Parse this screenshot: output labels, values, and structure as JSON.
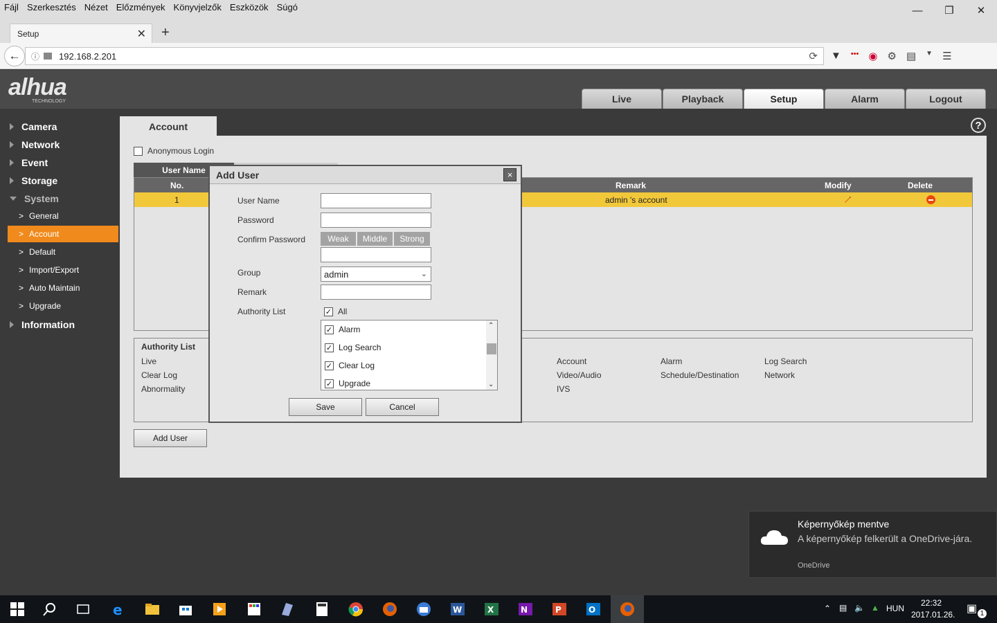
{
  "browser": {
    "menu": [
      "Fájl",
      "Szerkesztés",
      "Nézet",
      "Előzmények",
      "Könyvjelzők",
      "Eszközök",
      "Súgó"
    ],
    "tab_title": "Setup",
    "url": "192.168.2.201"
  },
  "header": {
    "logo": "alhua",
    "logo_sub": "TECHNOLOGY",
    "nav": [
      "Live",
      "Playback",
      "Setup",
      "Alarm",
      "Logout"
    ],
    "active_nav": "Setup"
  },
  "sidebar": {
    "items": [
      {
        "label": "Camera"
      },
      {
        "label": "Network"
      },
      {
        "label": "Event"
      },
      {
        "label": "Storage"
      },
      {
        "label": "System"
      }
    ],
    "system_sub": [
      "General",
      "Account",
      "Default",
      "Import/Export",
      "Auto Maintain",
      "Upgrade"
    ],
    "active_sub": "Account",
    "information": "Information"
  },
  "content": {
    "tab": "Account",
    "help": "?",
    "anonymous_login": "Anonymous Login",
    "user_tab": "User Name",
    "table": {
      "headers": {
        "no": "No.",
        "remark": "Remark",
        "modify": "Modify",
        "delete": "Delete"
      },
      "rows": [
        {
          "no": "1",
          "remark": "admin 's account"
        }
      ]
    },
    "authority": {
      "title": "Authority List",
      "col1": [
        "Live",
        "Clear Log",
        "Abnormality"
      ],
      "col2": [
        "Account",
        "Video/Audio",
        "IVS"
      ],
      "col3": [
        "Alarm",
        "Schedule/Destination"
      ],
      "col4": [
        "Log Search",
        "Network"
      ]
    },
    "add_user_button": "Add User"
  },
  "modal": {
    "title": "Add User",
    "close": "×",
    "labels": {
      "username": "User Name",
      "password": "Password",
      "confirm": "Confirm Password",
      "group": "Group",
      "remark": "Remark",
      "authority": "Authority List"
    },
    "strength": [
      "Weak",
      "Middle",
      "Strong"
    ],
    "group_value": "admin",
    "all_label": "All",
    "authority_items": [
      "Alarm",
      "Log Search",
      "Clear Log",
      "Upgrade"
    ],
    "save": "Save",
    "cancel": "Cancel"
  },
  "toast": {
    "title": "Képernyőkép mentve",
    "body": "A képernyőkép felkerült a OneDrive-jára.",
    "source": "OneDrive"
  },
  "tray": {
    "lang": "HUN",
    "time": "22:32",
    "date": "2017.01.26.",
    "notif_count": "1"
  }
}
